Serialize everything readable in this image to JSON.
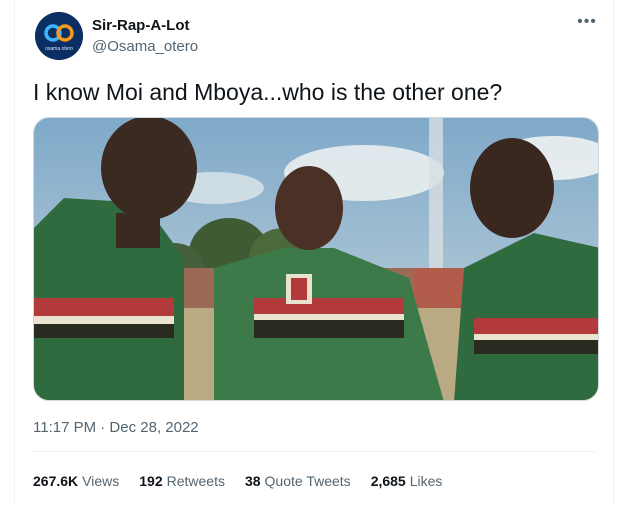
{
  "author": {
    "display_name": "Sir-Rap-A-Lot",
    "handle": "@Osama_otero",
    "avatar_text": "osama otero"
  },
  "tweet": {
    "text": "I know Moi and Mboya...who is the other one?",
    "timestamp": "11:17 PM · Dec 28, 2022"
  },
  "stats": [
    {
      "value": "267.6K",
      "label": "Views"
    },
    {
      "value": "192",
      "label": "Retweets"
    },
    {
      "value": "38",
      "label": "Quote Tweets"
    },
    {
      "value": "2,685",
      "label": "Likes"
    }
  ],
  "icons": {
    "more": "more-horizontal-icon"
  },
  "colors": {
    "text": "#0f1419",
    "secondary": "#536471",
    "border": "#cfd9de",
    "jersey_green": "#2f6b3f",
    "jersey_red": "#b23a3a"
  }
}
